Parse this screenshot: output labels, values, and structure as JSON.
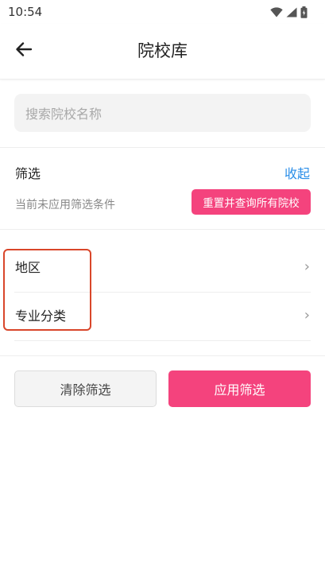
{
  "status_bar": {
    "time": "10:54",
    "icons": [
      "wifi-icon",
      "signal-icon",
      "battery-icon"
    ]
  },
  "app_bar": {
    "back_icon": "arrow-left-icon",
    "title": "院校库"
  },
  "search": {
    "placeholder": "搜索院校名称"
  },
  "filter": {
    "title": "筛选",
    "collapse_label": "收起",
    "status_text": "当前未应用筛选条件",
    "reset_button_label": "重置并查询所有院校"
  },
  "categories": [
    {
      "label": "地区",
      "chevron": "›"
    },
    {
      "label": "专业分类",
      "chevron": "›"
    }
  ],
  "actions": {
    "clear_label": "清除筛选",
    "apply_label": "应用筛选"
  },
  "colors": {
    "accent_pink": "#f4437d",
    "link_blue": "#2a8ee8",
    "highlight_red": "#d9462a"
  }
}
